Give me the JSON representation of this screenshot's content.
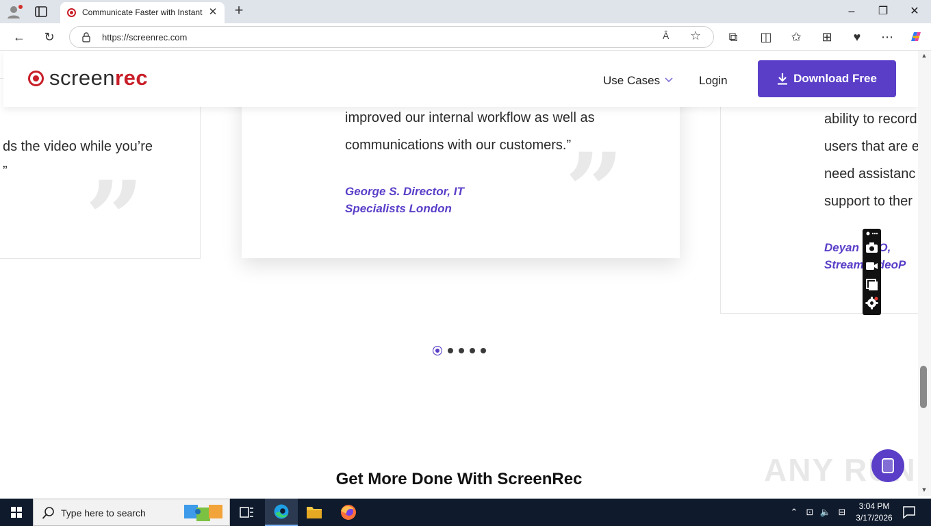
{
  "browser": {
    "tab_title": "Communicate Faster with Instant",
    "url": "https://screenrec.com",
    "read_aloud_label": "Â"
  },
  "header": {
    "logo_text_a": "screen",
    "logo_text_b": "rec",
    "nav_use_cases": "Use Cases",
    "nav_login": "Login",
    "download_label": "Download Free"
  },
  "testimonials": {
    "left": {
      "line1": "ds the video while you’re",
      "line2": "”"
    },
    "center": {
      "line1": "improved our internal workflow as well as",
      "line2": "communications with our customers.”",
      "author_line1": "George S. Director, IT",
      "author_line2": "Specialists London"
    },
    "right": {
      "line1": "ability to record",
      "line2": "users that are e",
      "line3": "need assistanc",
      "line4": "support to ther",
      "author_line1": "Deyan      CEO,",
      "author_line2": "Stream     VideoP"
    },
    "quote_glyph": "”"
  },
  "carousel": {
    "count": 5,
    "active_index": 0
  },
  "section": {
    "title": "Get More Done With ScreenRec"
  },
  "watermark": "ANY RUN",
  "taskbar": {
    "search_placeholder": "Type here to search",
    "time": "3:04 PM",
    "date": "3/17/2026"
  }
}
